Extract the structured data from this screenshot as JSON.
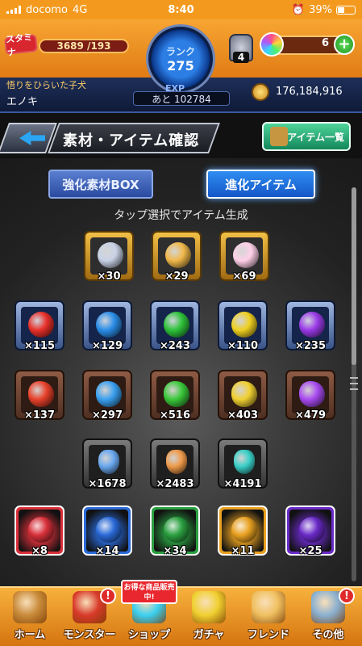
{
  "status_bar": {
    "carrier": "docomo",
    "network": "4G",
    "time": "8:40",
    "battery": "39%"
  },
  "header": {
    "stamina_label": "スタミナ",
    "stamina_value": "3689 /193",
    "rank_label": "ランク",
    "rank_value": "275",
    "exp_label": "EXP",
    "exp_remaining": "あと 102784",
    "hammer_count": "4",
    "orb_count": "6",
    "plus_symbol": "+",
    "user_title": "悟りをひらいた子犬",
    "user_name": "エノキ",
    "gold": "176,184,916"
  },
  "page": {
    "title": "素材・アイテム確認",
    "item_list_button": "アイテム一覧",
    "tab_enhance": "強化素材BOX",
    "tab_evolve": "進化アイテム",
    "hint": "タップ選択でアイテム生成"
  },
  "colors": {
    "header_orange": "#f39a1e",
    "tab_active": "#1e6fe0",
    "plus_green": "#2fb12f",
    "badge_red": "#e02a2a"
  },
  "items": {
    "row1": [
      {
        "name": "silver-crest-medal",
        "count": "×30",
        "frame": "gold",
        "color": "#c8d2e6"
      },
      {
        "name": "rainbow-ring",
        "count": "×29",
        "frame": "gold",
        "color": "#f0b84a"
      },
      {
        "name": "rainbow-flame-egg",
        "count": "×69",
        "frame": "gold",
        "color": "#ffd0e8"
      }
    ],
    "row2": [
      {
        "name": "red-orb",
        "count": "×115",
        "frame": "blue",
        "color": "#e8302a"
      },
      {
        "name": "blue-orb",
        "count": "×129",
        "frame": "blue",
        "color": "#2a8ee8"
      },
      {
        "name": "green-orb",
        "count": "×243",
        "frame": "blue",
        "color": "#2ec23a"
      },
      {
        "name": "yellow-orb",
        "count": "×110",
        "frame": "blue",
        "color": "#f0d020"
      },
      {
        "name": "purple-orb",
        "count": "×235",
        "frame": "blue",
        "color": "#9a3ae8"
      }
    ],
    "row3": [
      {
        "name": "red-stone",
        "count": "×137",
        "frame": "brown",
        "color": "#e8402a"
      },
      {
        "name": "blue-stone",
        "count": "×297",
        "frame": "brown",
        "color": "#3aa0f0"
      },
      {
        "name": "green-stone",
        "count": "×516",
        "frame": "brown",
        "color": "#3ac83a"
      },
      {
        "name": "yellow-stone",
        "count": "×403",
        "frame": "brown",
        "color": "#f0d030"
      },
      {
        "name": "purple-stone",
        "count": "×479",
        "frame": "brown",
        "color": "#a84af0"
      }
    ],
    "row4": [
      {
        "name": "blue-crystal",
        "count": "×1678",
        "frame": "grey",
        "color": "#6aa8f0"
      },
      {
        "name": "orange-crystal",
        "count": "×2483",
        "frame": "grey",
        "color": "#f09a4a"
      },
      {
        "name": "teal-crystal",
        "count": "×4191",
        "frame": "grey",
        "color": "#3ad0c8"
      }
    ],
    "row5": [
      {
        "name": "fire-monster",
        "count": "×8",
        "frame": "monster",
        "color": "#d8303a"
      },
      {
        "name": "water-monster",
        "count": "×14",
        "frame": "monster",
        "color": "#2a6ad8"
      },
      {
        "name": "wood-monster",
        "count": "×34",
        "frame": "monster",
        "color": "#2aa040"
      },
      {
        "name": "light-monster",
        "count": "×11",
        "frame": "monster",
        "color": "#e8a020"
      },
      {
        "name": "dark-monster",
        "count": "×25",
        "frame": "monster",
        "color": "#6a2ac8"
      }
    ]
  },
  "bottom_nav": [
    {
      "label": "ホーム",
      "color": "#c98b3a",
      "badge": ""
    },
    {
      "label": "モンスター",
      "color": "#d83a2a",
      "badge": "!"
    },
    {
      "label": "ショップ",
      "color": "#3ad0f0",
      "badge": "!"
    },
    {
      "label": "ガチャ",
      "color": "#f0d030",
      "badge": ""
    },
    {
      "label": "フレンド",
      "color": "#f0c060",
      "badge": ""
    },
    {
      "label": "その他",
      "color": "#8ab0d0",
      "badge": "!"
    }
  ],
  "promo_text": "お得な商品販売中!"
}
